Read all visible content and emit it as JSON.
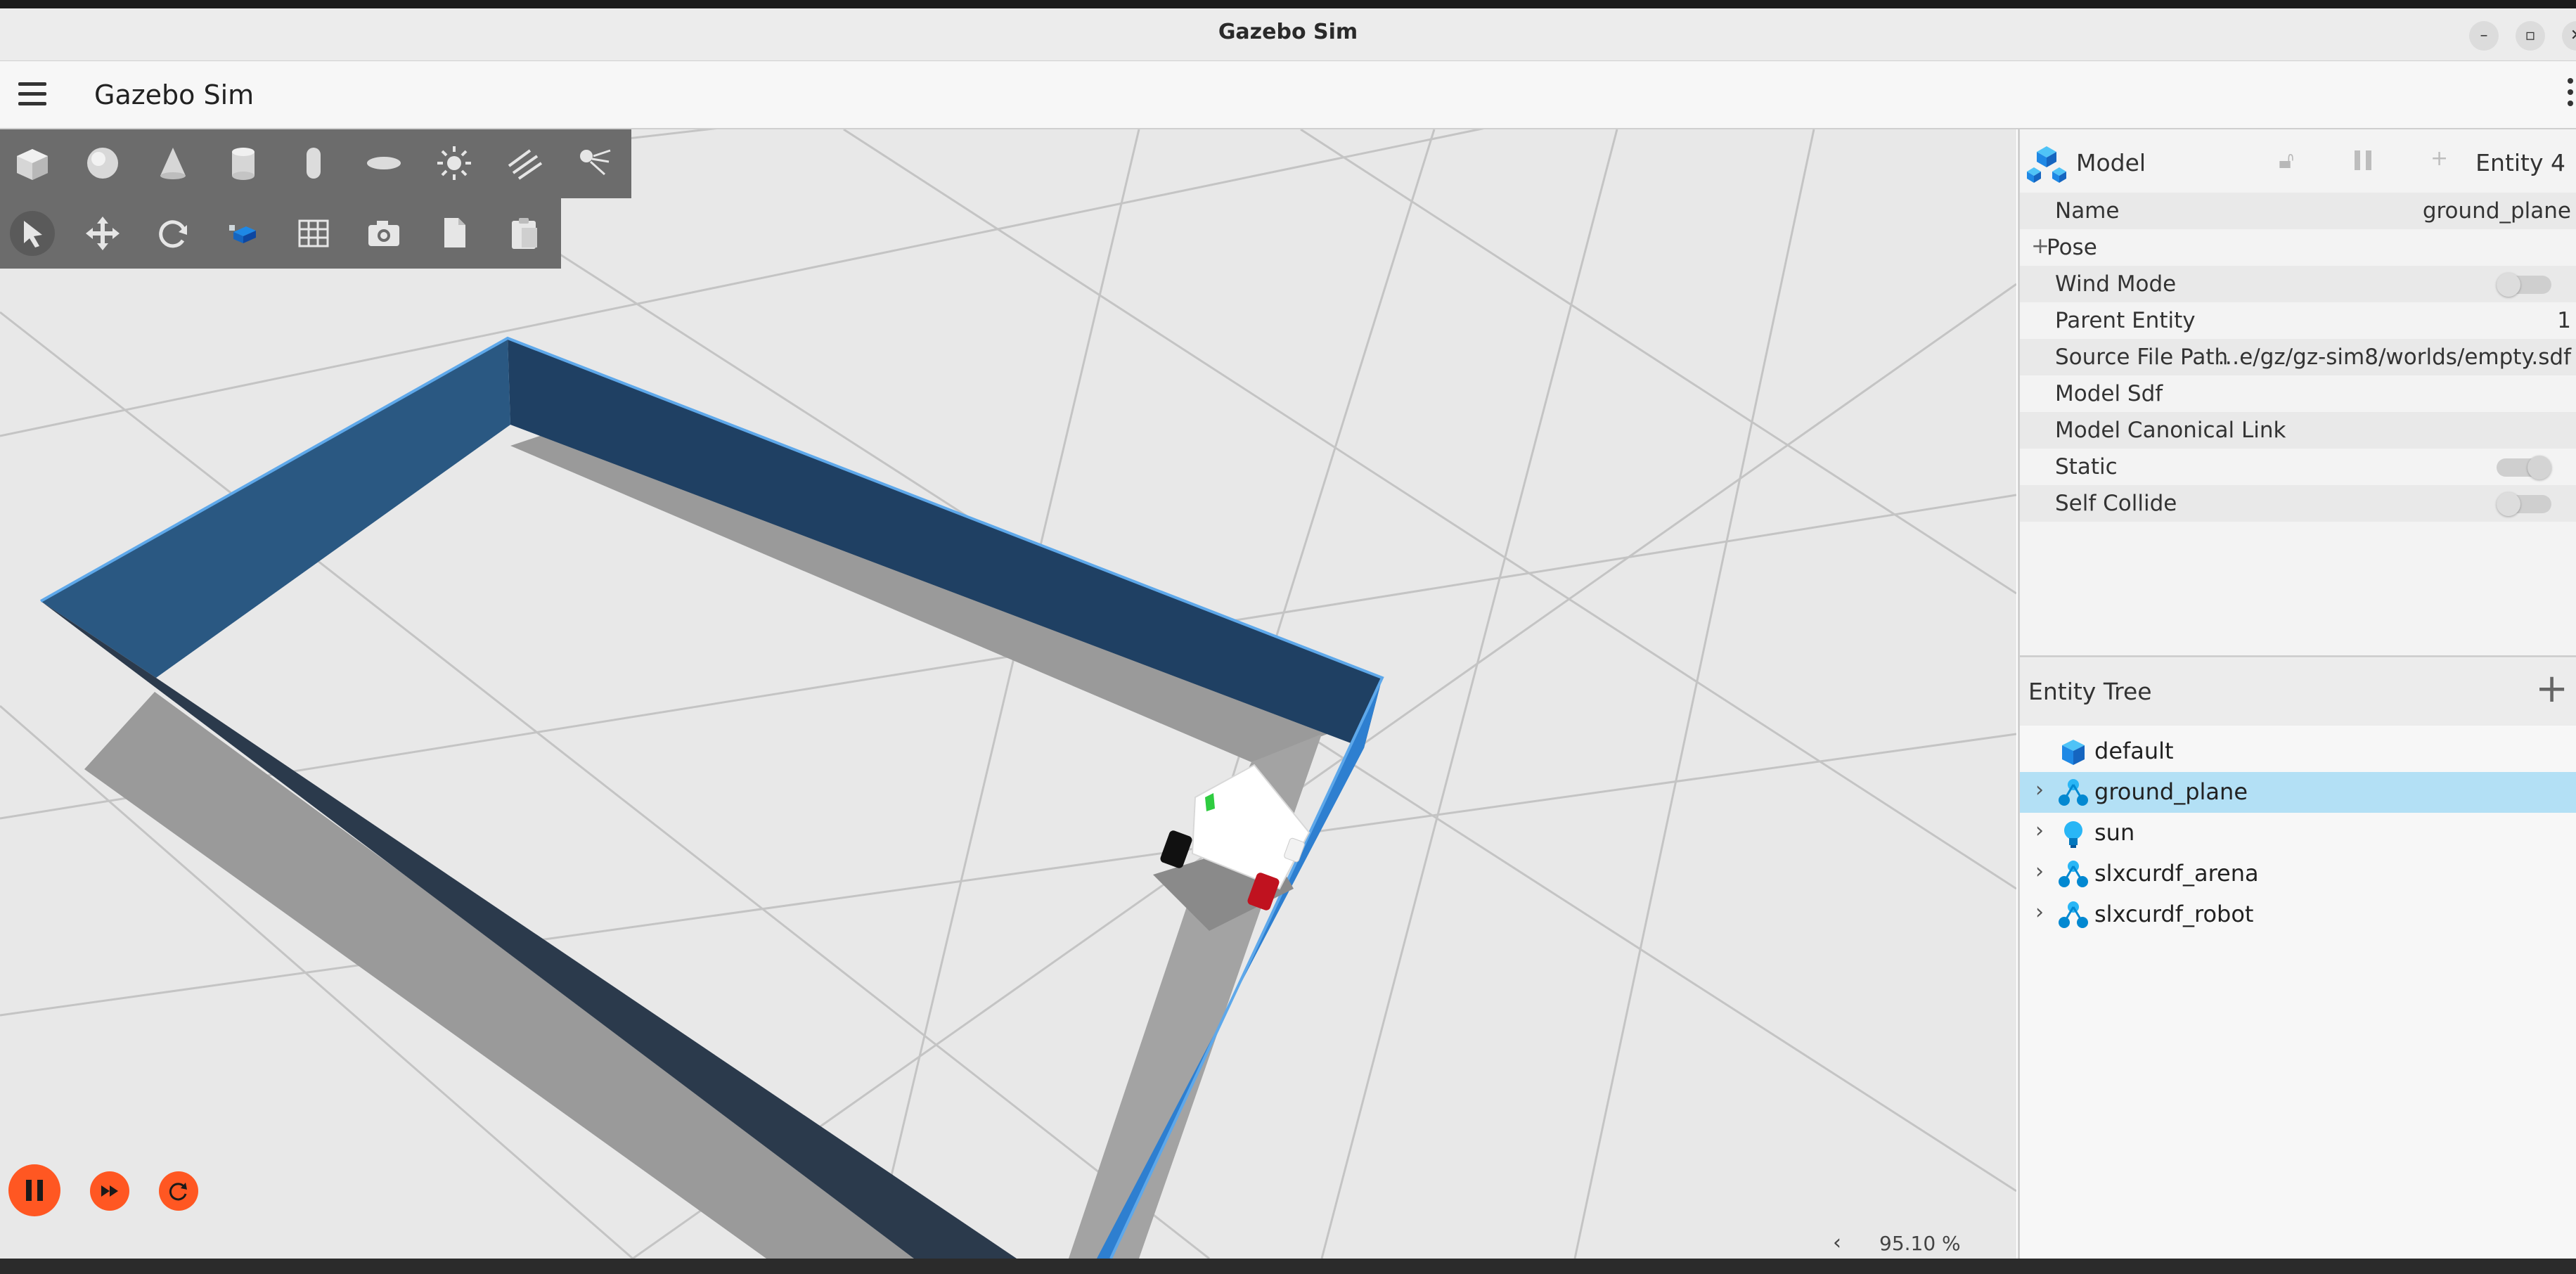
{
  "window": {
    "title": "Gazebo Sim"
  },
  "appbar": {
    "title": "Gazebo Sim"
  },
  "viewport": {
    "zoom": "95.10 %",
    "zoom_arrow": "‹"
  },
  "component_inspector": {
    "type": "Model",
    "entity": "Entity 4",
    "properties": [
      {
        "label": "Name",
        "value": "ground_plane"
      },
      {
        "label": "Pose",
        "prefix": "+"
      },
      {
        "label": "Wind Mode",
        "toggle": false
      },
      {
        "label": "Parent Entity",
        "value": "1"
      },
      {
        "label": "Source File Path",
        "value": "…e/gz/gz-sim8/worlds/empty.sdf"
      },
      {
        "label": "Model Sdf"
      },
      {
        "label": "Model Canonical Link"
      },
      {
        "label": "Static",
        "toggle": true
      },
      {
        "label": "Self Collide",
        "toggle": false
      }
    ]
  },
  "entity_tree": {
    "title": "Entity Tree",
    "add_label": "+",
    "items": [
      {
        "label": "default",
        "icon": "world-cube-icon",
        "expandable": false,
        "selected": false
      },
      {
        "label": "ground_plane",
        "icon": "model-icon",
        "expandable": true,
        "selected": true
      },
      {
        "label": "sun",
        "icon": "light-bulb-icon",
        "expandable": true,
        "selected": false
      },
      {
        "label": "slxcurdf_arena",
        "icon": "model-icon",
        "expandable": true,
        "selected": false
      },
      {
        "label": "slxcurdf_robot",
        "icon": "model-icon",
        "expandable": true,
        "selected": false
      }
    ]
  },
  "colors": {
    "accent": "#ff5722",
    "selection": "#b3e0f5",
    "wall": "#2b5a86",
    "toolbar": "#6c6c6c",
    "icon_blue": "#1ea7e0"
  },
  "toolbar_icons": [
    "box-icon",
    "sphere-icon",
    "cone-icon",
    "cylinder-icon",
    "capsule-icon",
    "ellipsoid-icon",
    "sun-light-icon",
    "directional-light-icon",
    "spot-light-icon",
    "select-icon",
    "translate-icon",
    "rotate-icon",
    "snap-icon",
    "grid-icon",
    "camera-icon",
    "copy-icon",
    "paste-icon"
  ]
}
